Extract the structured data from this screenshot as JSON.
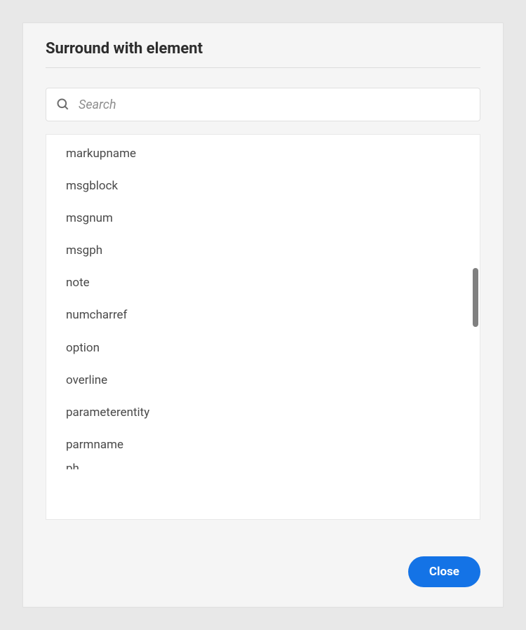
{
  "dialog": {
    "title": "Surround with element",
    "search_placeholder": "Search",
    "close_label": "Close"
  },
  "elements": [
    "markupname",
    "msgblock",
    "msgnum",
    "msgph",
    "note",
    "numcharref",
    "option",
    "overline",
    "parameterentity",
    "parmname",
    "ph"
  ]
}
